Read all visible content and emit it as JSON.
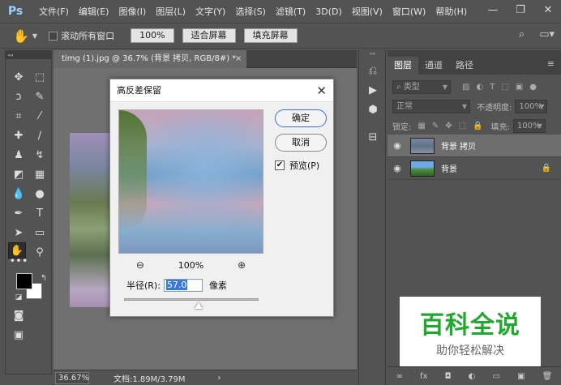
{
  "app": {
    "logo": "Ps"
  },
  "menu": [
    "文件(F)",
    "编辑(E)",
    "图像(I)",
    "图层(L)",
    "文字(Y)",
    "选择(S)",
    "滤镜(T)",
    "3D(D)",
    "视图(V)",
    "窗口(W)",
    "帮助(H)"
  ],
  "window_controls": {
    "minimize": "—",
    "restore": "❐",
    "close": "✕"
  },
  "options": {
    "scroll_all_label": "滚动所有窗口",
    "zoom_value": "100%",
    "fit_screen": "适合屏幕",
    "fill_screen": "填充屏幕"
  },
  "document": {
    "tab_title": "timg (1).jpg @ 36.7% (背景 拷贝, RGB/8#) *",
    "tab_close": "×",
    "zoom": "36.67%",
    "doc_info": "文档:1.89M/3.79M",
    "status_arrow": "›"
  },
  "dialog": {
    "title": "高反差保留",
    "close": "✕",
    "ok": "确定",
    "cancel": "取消",
    "preview_label": "预览(P)",
    "preview_checked": "✔",
    "zoom_percent": "100%",
    "radius_label": "半径(R):",
    "radius_value": "57.0",
    "radius_unit": "像素"
  },
  "layers_panel": {
    "tabs": [
      "图层",
      "通道",
      "路径"
    ],
    "menu_icon": "≡",
    "kind_label": "类型",
    "blend_mode": "正常",
    "opacity_label": "不透明度:",
    "opacity_value": "100%",
    "lock_label": "锁定:",
    "fill_label": "填充:",
    "fill_value": "100%",
    "layers": [
      {
        "name": "背景 拷贝",
        "selected": true
      },
      {
        "name": "背景",
        "locked": true
      }
    ],
    "bottom_icons": [
      "∞",
      "fx",
      "◘",
      "◐",
      "▭",
      "▣",
      "🗑"
    ]
  },
  "watermark": {
    "title": "百科全说",
    "subtitle": "助你轻松解决"
  },
  "colors": {
    "ui_bg": "#535353",
    "dialog_bg": "#f0f0f0",
    "watermark_green": "#1faa2e"
  }
}
